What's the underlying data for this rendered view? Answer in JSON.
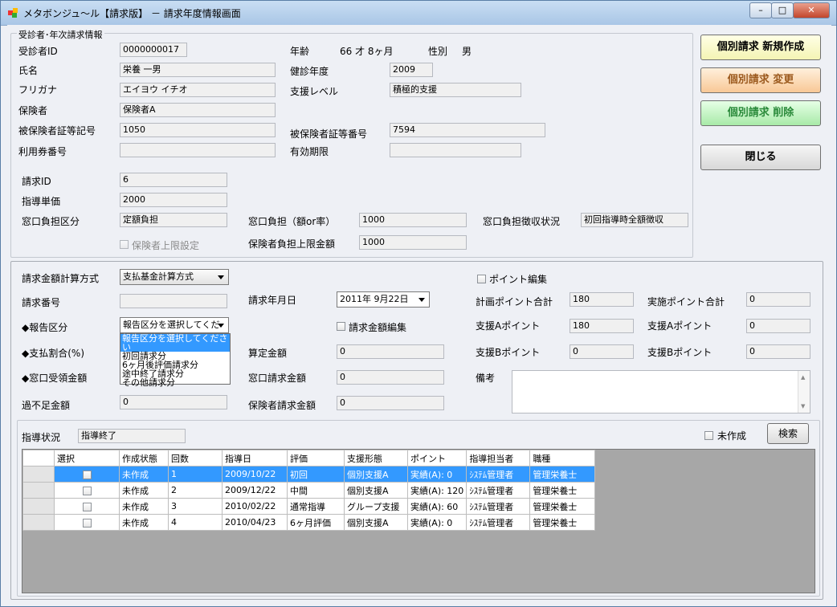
{
  "window": {
    "title": "メタボンジュ〜ル【請求版】 － 請求年度情報画面",
    "min": "–",
    "max": "□",
    "close": "✕"
  },
  "patient": {
    "group_title": "受診者･年次請求情報",
    "id_label": "受診者ID",
    "id_value": "0000000017",
    "age_label": "年齢",
    "age_value": "66 才 8ヶ月",
    "gender_label": "性別",
    "gender_value": "男",
    "name_label": "氏名",
    "name_value": "栄養 一男",
    "year_label": "健診年度",
    "year_value": "2009",
    "kana_label": "フリガナ",
    "kana_value": "エイヨウ イチオ",
    "support_label": "支援レベル",
    "support_value": "積極的支援",
    "insurer_label": "保険者",
    "insurer_value": "保険者A",
    "card_sym_label": "被保険者証等記号",
    "card_sym_value": "1050",
    "card_num_label": "被保険者証等番号",
    "card_num_value": "7594",
    "ticket_label": "利用券番号",
    "ticket_value": "",
    "expiry_label": "有効期限",
    "expiry_value": "",
    "bill_id_label": "請求ID",
    "bill_id_value": "6",
    "unit_label": "指導単価",
    "unit_value": "2000",
    "window_type_label": "窓口負担区分",
    "window_type_value": "定額負担",
    "window_amt_label": "窓口負担（額or率）",
    "window_amt_value": "1000",
    "collect_label": "窓口負担徴収状況",
    "collect_value": "初回指導時全額徴収",
    "limit_chk_label": "保険者上限設定",
    "limit_label": "保険者負担上限金額",
    "limit_value": "1000"
  },
  "actions": {
    "create": "個別請求 新規作成",
    "change": "個別請求 変更",
    "delete": "個別請求 削除",
    "close": "閉じる"
  },
  "billing": {
    "method_label": "請求金額計算方式",
    "method_value": "支払基金計算方式",
    "point_edit_label": "ポイント編集",
    "bill_no_label": "請求番号",
    "bill_no_value": "",
    "bill_date_label": "請求年月日",
    "bill_date_value": "2011年 9月22日",
    "plan_pt_label": "計画ポイント合計",
    "plan_pt_value": "180",
    "actual_pt_label": "実施ポイント合計",
    "actual_pt_value": "0",
    "report_label": "◆報告区分",
    "report_value": "報告区分を選択してくだ",
    "amount_edit_label": "請求金額編集",
    "sa_plan_label": "支援Aポイント",
    "sa_plan_value": "180",
    "sa_actual_label": "支援Aポイント",
    "sa_actual_value": "0",
    "pay_rate_label": "◆支払割合(%)",
    "calc_label": "算定金額",
    "calc_value": "0",
    "sb_plan_label": "支援Bポイント",
    "sb_plan_value": "0",
    "sb_actual_label": "支援Bポイント",
    "sb_actual_value": "0",
    "window_recv_label": "◆窓口受領金額",
    "window_bill_label": "窓口請求金額",
    "window_bill_value": "0",
    "remarks_label": "備考",
    "shortage_label": "過不足金額",
    "shortage_value": "0",
    "insurer_bill_label": "保険者請求金額",
    "insurer_bill_value": "0",
    "dropdown_options": [
      "報告区分を選択してください",
      "初回請求分",
      "6ヶ月後評価請求分",
      "途中終了請求分",
      "その他請求分"
    ]
  },
  "guidance": {
    "status_label": "指導状況",
    "status_value": "指導終了",
    "uncreated_label": "未作成",
    "search_button": "検索",
    "columns": [
      "選択",
      "作成状態",
      "回数",
      "指導日",
      "評価",
      "支援形態",
      "ポイント",
      "指導担当者",
      "職種"
    ],
    "rows": [
      {
        "state": "未作成",
        "count": "1",
        "date": "2009/10/22",
        "eval": "初回",
        "form": "個別支援A",
        "point": "実績(A): 0",
        "staff": "ｼｽﾃﾑ管理者",
        "job": "管理栄養士"
      },
      {
        "state": "未作成",
        "count": "2",
        "date": "2009/12/22",
        "eval": "中間",
        "form": "個別支援A",
        "point": "実績(A): 120",
        "staff": "ｼｽﾃﾑ管理者",
        "job": "管理栄養士"
      },
      {
        "state": "未作成",
        "count": "3",
        "date": "2010/02/22",
        "eval": "通常指導",
        "form": "グループ支援",
        "point": "実績(A): 60",
        "staff": "ｼｽﾃﾑ管理者",
        "job": "管理栄養士"
      },
      {
        "state": "未作成",
        "count": "4",
        "date": "2010/04/23",
        "eval": "6ヶ月評価",
        "form": "個別支援A",
        "point": "実績(A): 0",
        "staff": "ｼｽﾃﾑ管理者",
        "job": "管理栄養士"
      }
    ]
  }
}
